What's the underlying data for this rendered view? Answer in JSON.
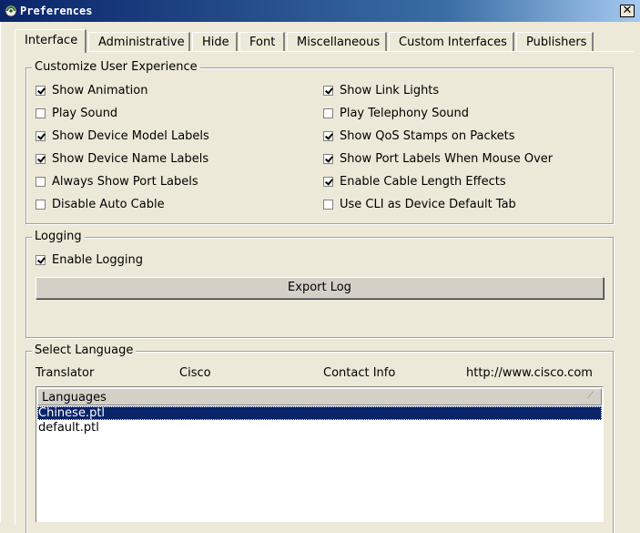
{
  "window": {
    "title": "Preferences",
    "close_glyph": "✕"
  },
  "tabs": [
    {
      "label": "Interface",
      "active": true
    },
    {
      "label": "Administrative"
    },
    {
      "label": "Hide"
    },
    {
      "label": "Font"
    },
    {
      "label": "Miscellaneous"
    },
    {
      "label": "Custom Interfaces"
    },
    {
      "label": "Publishers"
    }
  ],
  "customize": {
    "title": "Customize User Experience",
    "left": [
      {
        "label": "Show Animation",
        "checked": true
      },
      {
        "label": "Play Sound",
        "checked": false
      },
      {
        "label": "Show Device Model Labels",
        "checked": true
      },
      {
        "label": "Show Device Name Labels",
        "checked": true
      },
      {
        "label": "Always Show Port Labels",
        "checked": false
      },
      {
        "label": "Disable Auto Cable",
        "checked": false
      }
    ],
    "right": [
      {
        "label": "Show Link Lights",
        "checked": true
      },
      {
        "label": "Play Telephony Sound",
        "checked": false
      },
      {
        "label": "Show QoS Stamps on Packets",
        "checked": true
      },
      {
        "label": "Show Port Labels When Mouse Over",
        "checked": true
      },
      {
        "label": "Enable Cable Length Effects",
        "checked": true
      },
      {
        "label": "Use CLI as Device Default Tab",
        "checked": false
      }
    ]
  },
  "logging": {
    "title": "Logging",
    "enable": {
      "label": "Enable Logging",
      "checked": true
    },
    "export_label": "Export Log"
  },
  "language": {
    "title": "Select Language",
    "translator_label": "Translator",
    "translator_value": "Cisco",
    "contact_label": "Contact Info",
    "contact_value": "http://www.cisco.com",
    "list_header": "Languages",
    "items": [
      {
        "label": "Chinese.ptl",
        "selected": true
      },
      {
        "label": "default.ptl",
        "selected": false
      }
    ]
  }
}
